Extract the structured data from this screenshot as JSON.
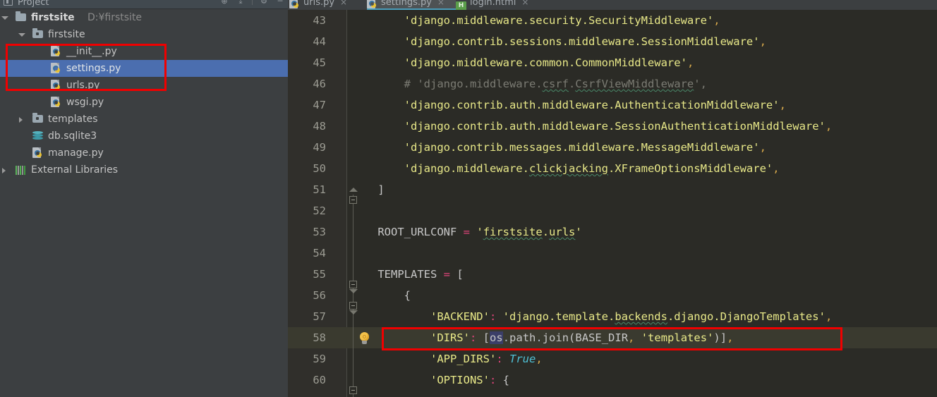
{
  "window": {
    "tool_window_title": "Project",
    "tool_buttons": [
      {
        "name": "locate-icon",
        "glyph": "⊕"
      },
      {
        "name": "collapse-all-icon",
        "glyph": "⤓"
      },
      {
        "name": "settings-gear-icon",
        "glyph": "⚙"
      },
      {
        "name": "hide-icon",
        "glyph": "─"
      }
    ]
  },
  "project_tree": [
    {
      "label": "firstsite",
      "subpath": "D:¥firstsite",
      "icon": "folder-icon",
      "indent": 22,
      "arrow": "open",
      "bold": true,
      "selected": false
    },
    {
      "label": "firstsite",
      "subpath": "",
      "icon": "source-folder-icon",
      "indent": 46,
      "arrow": "open",
      "bold": false,
      "selected": false
    },
    {
      "label": "__init__.py",
      "subpath": "",
      "icon": "python-file-icon",
      "indent": 72,
      "arrow": "none",
      "bold": false,
      "selected": false
    },
    {
      "label": "settings.py",
      "subpath": "",
      "icon": "python-file-icon",
      "indent": 72,
      "arrow": "none",
      "bold": false,
      "selected": true
    },
    {
      "label": "urls.py",
      "subpath": "",
      "icon": "python-file-icon",
      "indent": 72,
      "arrow": "none",
      "bold": false,
      "selected": false
    },
    {
      "label": "wsgi.py",
      "subpath": "",
      "icon": "python-file-icon",
      "indent": 72,
      "arrow": "none",
      "bold": false,
      "selected": false
    },
    {
      "label": "templates",
      "subpath": "",
      "icon": "source-folder-icon",
      "indent": 46,
      "arrow": "closed",
      "bold": false,
      "selected": false
    },
    {
      "label": "db.sqlite3",
      "subpath": "",
      "icon": "database-icon",
      "indent": 46,
      "arrow": "none",
      "bold": false,
      "selected": false
    },
    {
      "label": "manage.py",
      "subpath": "",
      "icon": "python-file-icon",
      "indent": 46,
      "arrow": "none",
      "bold": false,
      "selected": false
    },
    {
      "label": "External Libraries",
      "subpath": "",
      "icon": "libraries-icon",
      "indent": 22,
      "arrow": "closed",
      "bold": false,
      "selected": false
    }
  ],
  "editor_tabs": [
    {
      "label": "urls.py",
      "icon": "python-file-icon",
      "active": false,
      "close": "×"
    },
    {
      "label": "settings.py",
      "icon": "python-file-icon",
      "active": true,
      "close": "×"
    },
    {
      "label": "login.html",
      "icon": "html-file-icon",
      "active": false,
      "close": "×"
    }
  ],
  "code": {
    "file": "settings.py",
    "first_line_number": 43,
    "current_line": 58,
    "lines": [
      {
        "n": 43,
        "text": "        'django.middleware.security.SecurityMiddleware',"
      },
      {
        "n": 44,
        "text": "        'django.contrib.sessions.middleware.SessionMiddleware',"
      },
      {
        "n": 45,
        "text": "        'django.middleware.common.CommonMiddleware',"
      },
      {
        "n": 46,
        "text": "        # 'django.middleware.csrf.CsrfViewMiddleware',"
      },
      {
        "n": 47,
        "text": "        'django.contrib.auth.middleware.AuthenticationMiddleware',"
      },
      {
        "n": 48,
        "text": "        'django.contrib.auth.middleware.SessionAuthenticationMiddleware',"
      },
      {
        "n": 49,
        "text": "        'django.contrib.messages.middleware.MessageMiddleware',"
      },
      {
        "n": 50,
        "text": "        'django.middleware.clickjacking.XFrameOptionsMiddleware',"
      },
      {
        "n": 51,
        "text": "    ]"
      },
      {
        "n": 52,
        "text": ""
      },
      {
        "n": 53,
        "text": "    ROOT_URLCONF = 'firstsite.urls'"
      },
      {
        "n": 54,
        "text": ""
      },
      {
        "n": 55,
        "text": "    TEMPLATES = ["
      },
      {
        "n": 56,
        "text": "        {"
      },
      {
        "n": 57,
        "text": "            'BACKEND': 'django.template.backends.django.DjangoTemplates',"
      },
      {
        "n": 58,
        "text": "            'DIRS': [os.path.join(BASE_DIR, 'templates')],"
      },
      {
        "n": 59,
        "text": "            'APP_DIRS': True,"
      },
      {
        "n": 60,
        "text": "            'OPTIONS': {"
      }
    ]
  },
  "colors": {
    "sidebar_bg": "#3c3f41",
    "editor_bg": "#2b2b26",
    "gutter_bg": "#302f2b",
    "selection_blue": "#4b6eaf",
    "annotation_red": "#f00000",
    "tab_active_underline": "#4a9ebb",
    "current_line_bg": "#3a3a2f",
    "string_yellow": "#e8e888",
    "keyword_orange": "#cc7832",
    "operator_pink": "#e0457b",
    "constant_cyan": "#4fc1d6",
    "comment_gray": "#7b7b73"
  },
  "annotations": [
    {
      "name": "sidebar-files-highlight",
      "target": "__init__.py / settings.py / urls.py"
    },
    {
      "name": "dirs-line-highlight",
      "target": "line 58 'DIRS'"
    }
  ]
}
